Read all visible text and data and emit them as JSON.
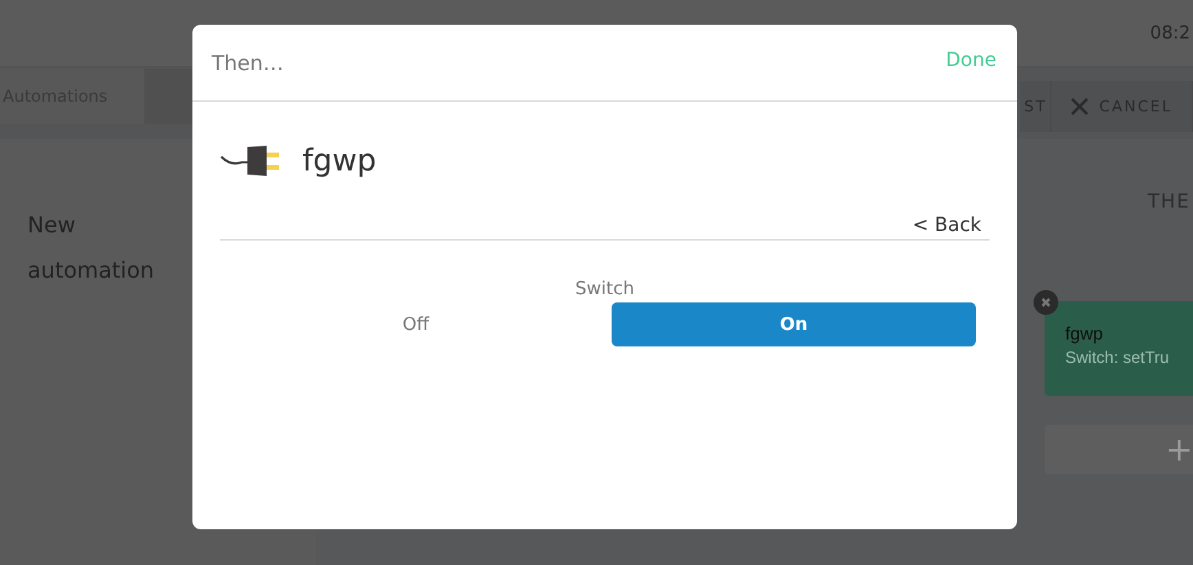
{
  "status_bar": {
    "time": "08:2"
  },
  "nav_tab": {
    "label": "Automations"
  },
  "toolbar": [
    {
      "kind": "text",
      "label": "ST"
    },
    {
      "kind": "close",
      "label": "CANCEL"
    }
  ],
  "sidebar": {
    "title": "New automation"
  },
  "main": {
    "heading": "THE",
    "actions": [
      {
        "device": "fgwp",
        "detail": "Switch: setTru"
      }
    ],
    "add_label": "+"
  },
  "dialog": {
    "title": "Then…",
    "done": "Done",
    "device": "fgwp",
    "back": "< Back",
    "control": {
      "label": "Switch",
      "options": [
        {
          "label": "Off",
          "selected": false
        },
        {
          "label": "On",
          "selected": true
        }
      ]
    }
  }
}
